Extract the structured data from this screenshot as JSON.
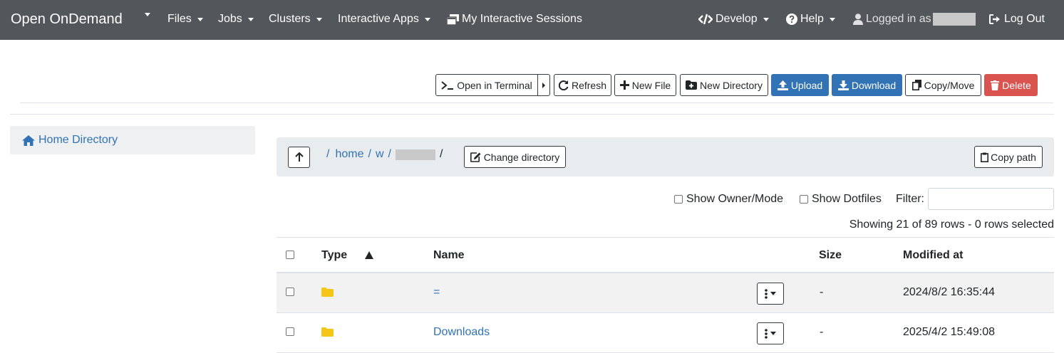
{
  "navbar": {
    "brand": "Open OnDemand",
    "items": [
      {
        "label": "Files"
      },
      {
        "label": "Jobs"
      },
      {
        "label": "Clusters"
      },
      {
        "label": "Interactive Apps"
      },
      {
        "label": "My Interactive Sessions"
      }
    ],
    "right": {
      "develop": "Develop",
      "help": "Help",
      "logged_in": "Logged in as",
      "logout": "Log Out"
    }
  },
  "toolbar": {
    "open_terminal": "Open in Terminal",
    "refresh": "Refresh",
    "new_file": "New File",
    "new_directory": "New Directory",
    "upload": "Upload",
    "download": "Download",
    "copy_move": "Copy/Move",
    "delete": "Delete"
  },
  "sidebar": {
    "home": "Home Directory"
  },
  "breadcrumb": {
    "root_sep": "/",
    "home": "home",
    "w": "w",
    "change_directory": "Change directory",
    "copy_path": "Copy path"
  },
  "options": {
    "show_owner_mode": "Show Owner/Mode",
    "show_dotfiles": "Show Dotfiles",
    "filter_label": "Filter:",
    "filter_value": "",
    "showing": "Showing 21 of 89 rows - 0 rows selected"
  },
  "table": {
    "headers": {
      "type": "Type",
      "name": "Name",
      "size": "Size",
      "modified": "Modified at"
    },
    "rows": [
      {
        "name": "=",
        "size": "-",
        "modified": "2024/8/2 16:35:44"
      },
      {
        "name": "Downloads",
        "size": "-",
        "modified": "2025/4/2 15:49:08"
      }
    ]
  },
  "colors": {
    "navbar_bg": "#53565a",
    "link": "#3173b4",
    "primary": "#3173b4",
    "danger": "#d9534f",
    "folder": "#f5c518"
  }
}
